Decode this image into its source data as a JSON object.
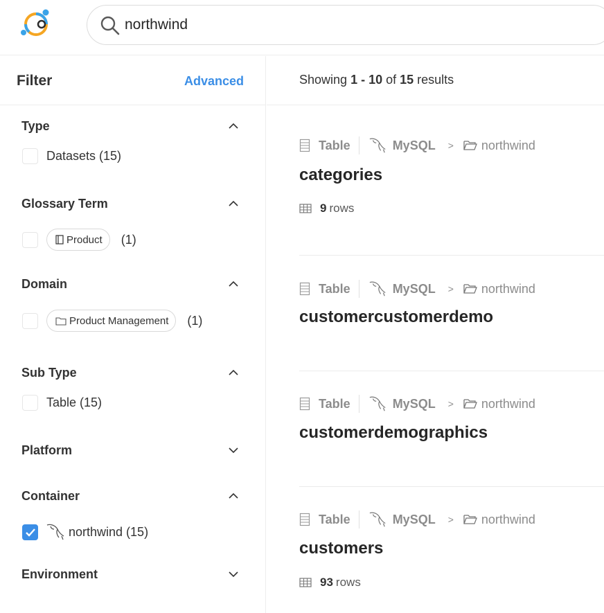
{
  "search": {
    "value": "northwind"
  },
  "filter": {
    "title": "Filter",
    "advanced_label": "Advanced",
    "facets": {
      "type": {
        "title": "Type",
        "expanded": true,
        "option": {
          "label": "Datasets (15)",
          "checked": false
        }
      },
      "glossary": {
        "title": "Glossary Term",
        "expanded": true,
        "option": {
          "tag": "Product",
          "count": "(1)",
          "checked": false
        }
      },
      "domain": {
        "title": "Domain",
        "expanded": true,
        "option": {
          "tag": "Product Management",
          "count": "(1)",
          "checked": false
        }
      },
      "subtype": {
        "title": "Sub Type",
        "expanded": true,
        "option": {
          "label": "Table (15)",
          "checked": false
        }
      },
      "platform": {
        "title": "Platform",
        "expanded": false
      },
      "container": {
        "title": "Container",
        "expanded": true,
        "option": {
          "label": "northwind (15)",
          "checked": true,
          "icon": "mysql-dolphin-icon"
        }
      },
      "environment": {
        "title": "Environment",
        "expanded": false
      }
    }
  },
  "results": {
    "summary": {
      "prefix": "Showing ",
      "range": "1 - 10",
      "of": " of ",
      "total": "15",
      "suffix": " results"
    },
    "items": [
      {
        "type": "Table",
        "platform": "MySQL",
        "container": "northwind",
        "name": "categories",
        "rows": "9",
        "rows_label": "rows"
      },
      {
        "type": "Table",
        "platform": "MySQL",
        "container": "northwind",
        "name": "customercustomerdemo"
      },
      {
        "type": "Table",
        "platform": "MySQL",
        "container": "northwind",
        "name": "customerdemographics"
      },
      {
        "type": "Table",
        "platform": "MySQL",
        "container": "northwind",
        "name": "customers",
        "rows": "93",
        "rows_label": "rows"
      }
    ]
  },
  "colors": {
    "accent": "#3b8ee6",
    "text": "#262626",
    "muted": "#8c8c8c",
    "border": "#ededed"
  }
}
